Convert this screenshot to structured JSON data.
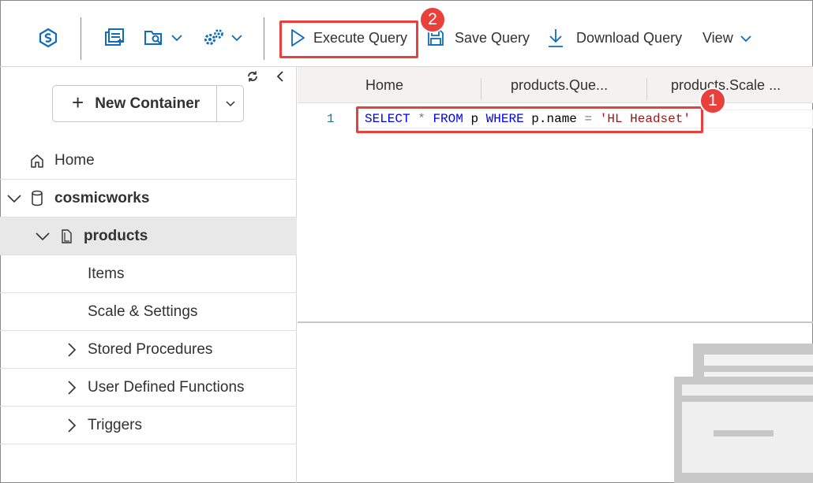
{
  "toolbar": {
    "icons": [
      "cosmos-logo-icon",
      "new-sql-query-icon",
      "open-query-icon",
      "settings-icon"
    ],
    "execute_label": "Execute Query",
    "save_label": "Save Query",
    "download_label": "Download Query",
    "view_label": "View"
  },
  "annotations": {
    "badge_1": "1",
    "badge_2": "2",
    "color": "#e8403a"
  },
  "sidebar": {
    "refresh_icon": "refresh-icon",
    "collapse_icon": "chevron-left-icon",
    "new_container_label": "New Container",
    "tree": {
      "home": "Home",
      "database": "cosmicworks",
      "container": "products",
      "items": "Items",
      "scale_settings": "Scale & Settings",
      "stored_procedures": "Stored Procedures",
      "udfs": "User Defined Functions",
      "triggers": "Triggers"
    }
  },
  "tabs": [
    "Home",
    "products.Que...",
    "products.Scale ..."
  ],
  "editor": {
    "line_number": "1",
    "tokens": {
      "select": "SELECT",
      "star": "*",
      "from": "FROM",
      "alias": "p",
      "where": "WHERE",
      "prop": "p.name",
      "eq": "=",
      "value": "'HL Headset'"
    }
  },
  "colors": {
    "accent": "#0f6cbd",
    "keyword": "#0000ff",
    "string": "#a31515"
  }
}
